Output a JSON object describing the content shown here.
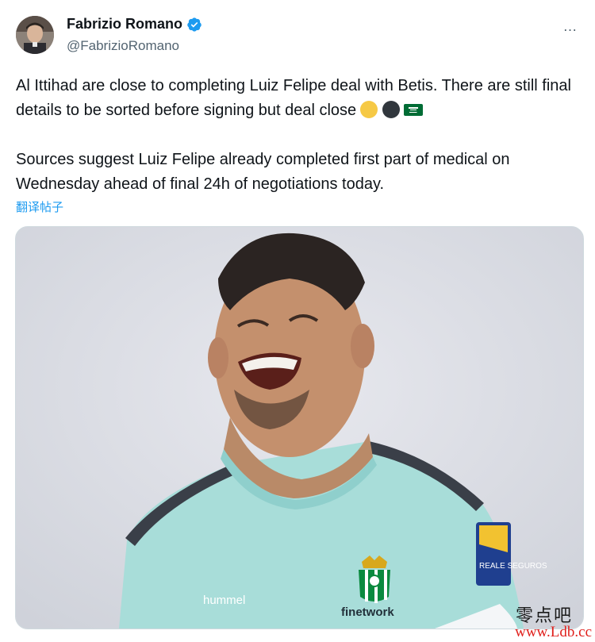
{
  "tweet": {
    "author_name": "Fabrizio Romano",
    "handle": "@FabrizioRomano",
    "more_icon": "…",
    "paragraph_1": "Al Ittihad are close to completing Luiz Felipe deal with Betis. There are still final details to be sorted before signing but deal close",
    "paragraph_2": "Sources suggest Luiz Felipe already completed first part of medical on Wednesday ahead of final 24h of negotiations today.",
    "emojis": [
      "yellow-circle-icon",
      "black-circle-icon",
      "saudi-arabia-flag-icon"
    ],
    "translate_label": "翻译帖子"
  },
  "media": {
    "shirt_sponsor": "finetwork",
    "kit_brand": "hummel",
    "sleeve_badge": "REALE SEGUROS"
  },
  "watermark": {
    "cn_text": "零点吧",
    "url_text": "www.Ldb.cc"
  },
  "colors": {
    "link_blue": "#1d9bf0",
    "verified_blue": "#1d9bf0",
    "secondary_text": "#536471",
    "shirt_mint": "#a8ddd9",
    "watermark_red": "#e0201c"
  }
}
